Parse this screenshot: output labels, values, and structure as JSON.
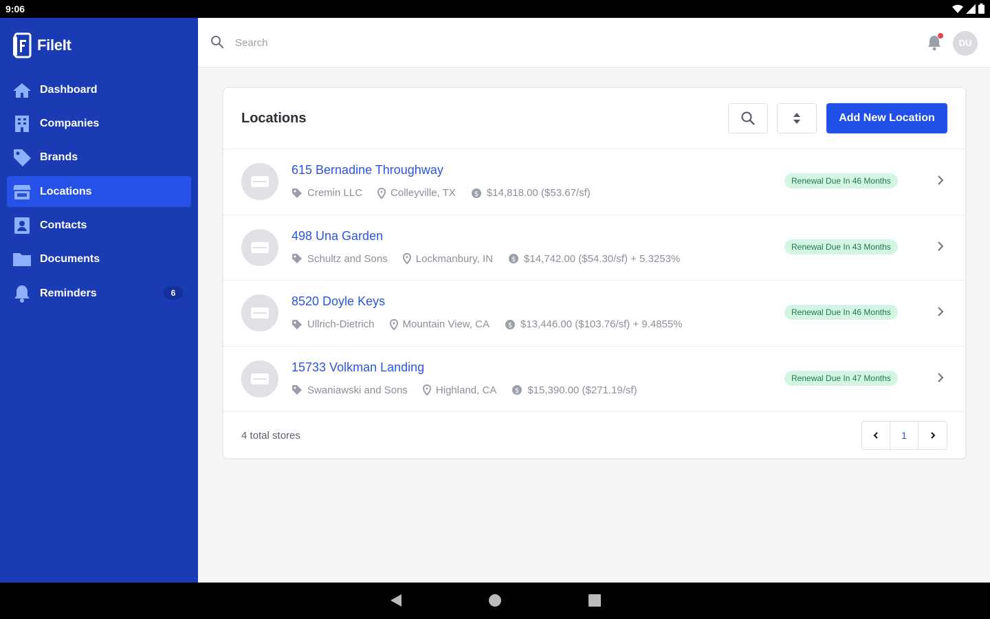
{
  "status_bar": {
    "time": "9:06"
  },
  "app": {
    "name": "FileIt"
  },
  "sidebar": {
    "items": [
      {
        "label": "Dashboard",
        "icon": "home-icon"
      },
      {
        "label": "Companies",
        "icon": "building-icon"
      },
      {
        "label": "Brands",
        "icon": "tag-icon"
      },
      {
        "label": "Locations",
        "icon": "store-icon",
        "active": true
      },
      {
        "label": "Contacts",
        "icon": "contact-card-icon"
      },
      {
        "label": "Documents",
        "icon": "folder-icon"
      },
      {
        "label": "Reminders",
        "icon": "bell-icon",
        "badge": "6"
      }
    ]
  },
  "topbar": {
    "search_placeholder": "Search",
    "avatar_initials": "DU"
  },
  "card": {
    "title": "Locations",
    "add_button": "Add New Location",
    "rows": [
      {
        "title": "615 Bernadine Throughway",
        "company": "Cremin LLC",
        "city": "Colleyville, TX",
        "rent": "$14,818.00 ($53.67/sf)",
        "badge": "Renewal Due In 46 Months"
      },
      {
        "title": "498 Una Garden",
        "company": "Schultz and Sons",
        "city": "Lockmanbury, IN",
        "rent": "$14,742.00 ($54.30/sf) + 5.3253%",
        "badge": "Renewal Due In 43 Months"
      },
      {
        "title": "8520 Doyle Keys",
        "company": "Ullrich-Dietrich",
        "city": "Mountain View, CA",
        "rent": "$13,446.00 ($103.76/sf) + 9.4855%",
        "badge": "Renewal Due In 46 Months"
      },
      {
        "title": "15733 Volkman Landing",
        "company": "Swaniawski and Sons",
        "city": "Highland, CA",
        "rent": "$15,390.00 ($271.19/sf)",
        "badge": "Renewal Due In 47 Months"
      }
    ],
    "total": "4 total stores",
    "page": "1"
  },
  "colors": {
    "sidebar": "#1a3bb3",
    "accent": "#2150e8",
    "active_nav": "#2551e6",
    "badge_bg": "#d4f5e3",
    "badge_text": "#1c7a4b"
  }
}
